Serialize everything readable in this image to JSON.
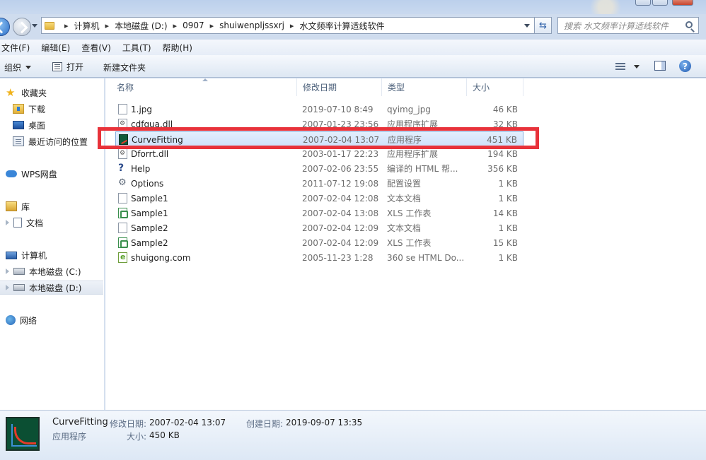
{
  "address": {
    "crumbs": [
      "计算机",
      "本地磁盘 (D:)",
      "0907",
      "shuiwenpljssxrj",
      "水文频率计算适线软件"
    ],
    "search_placeholder": "搜索 水文频率计算适线软件"
  },
  "menu": [
    "文件(F)",
    "编辑(E)",
    "查看(V)",
    "工具(T)",
    "帮助(H)"
  ],
  "toolbar": {
    "organize": "组织",
    "open": "打开",
    "new_folder": "新建文件夹"
  },
  "nav": {
    "favorites": "收藏夹",
    "downloads": "下载",
    "desktop": "桌面",
    "recent": "最近访问的位置",
    "wps": "WPS网盘",
    "library": "库",
    "documents": "文档",
    "computer": "计算机",
    "drive_c": "本地磁盘 (C:)",
    "drive_d": "本地磁盘 (D:)",
    "network": "网络"
  },
  "columns": {
    "name": "名称",
    "date": "修改日期",
    "type": "类型",
    "size": "大小"
  },
  "files": [
    {
      "name": "1.jpg",
      "date": "2019-07-10 8:49",
      "type": "qyimg_jpg",
      "size": "46 KB",
      "icon": "file-icon"
    },
    {
      "name": "cdfqua.dll",
      "date": "2007-01-23 23:56",
      "type": "应用程序扩展",
      "size": "32 KB",
      "icon": "dll-icon"
    },
    {
      "name": "CurveFitting",
      "date": "2007-02-04 13:07",
      "type": "应用程序",
      "size": "451 KB",
      "icon": "app-icon"
    },
    {
      "name": "Dforrt.dll",
      "date": "2003-01-17 22:23",
      "type": "应用程序扩展",
      "size": "194 KB",
      "icon": "dll-icon"
    },
    {
      "name": "Help",
      "date": "2007-02-06 23:55",
      "type": "编译的 HTML 帮...",
      "size": "356 KB",
      "icon": "help-icon"
    },
    {
      "name": "Options",
      "date": "2011-07-12 19:08",
      "type": "配置设置",
      "size": "1 KB",
      "icon": "settings-icon"
    },
    {
      "name": "Sample1",
      "date": "2007-02-04 12:08",
      "type": "文本文档",
      "size": "1 KB",
      "icon": "text-file-icon"
    },
    {
      "name": "Sample1",
      "date": "2007-02-04 13:08",
      "type": "XLS 工作表",
      "size": "14 KB",
      "icon": "xls-icon"
    },
    {
      "name": "Sample2",
      "date": "2007-02-04 12:09",
      "type": "文本文档",
      "size": "1 KB",
      "icon": "text-file-icon"
    },
    {
      "name": "Sample2",
      "date": "2007-02-04 12:09",
      "type": "XLS 工作表",
      "size": "15 KB",
      "icon": "xls-icon"
    },
    {
      "name": "shuigong.com",
      "date": "2005-11-23 1:28",
      "type": "360 se HTML Do...",
      "size": "1 KB",
      "icon": "html-file-icon"
    }
  ],
  "details": {
    "name": "CurveFitting",
    "type": "应用程序",
    "modified_label": "修改日期:",
    "modified": "2007-02-04 13:07",
    "size_label": "大小:",
    "size": "450 KB",
    "created_label": "创建日期:",
    "created": "2019-09-07 13:35"
  },
  "colors": {
    "highlight": "#e8323a",
    "selection": "#cfe2fb"
  }
}
